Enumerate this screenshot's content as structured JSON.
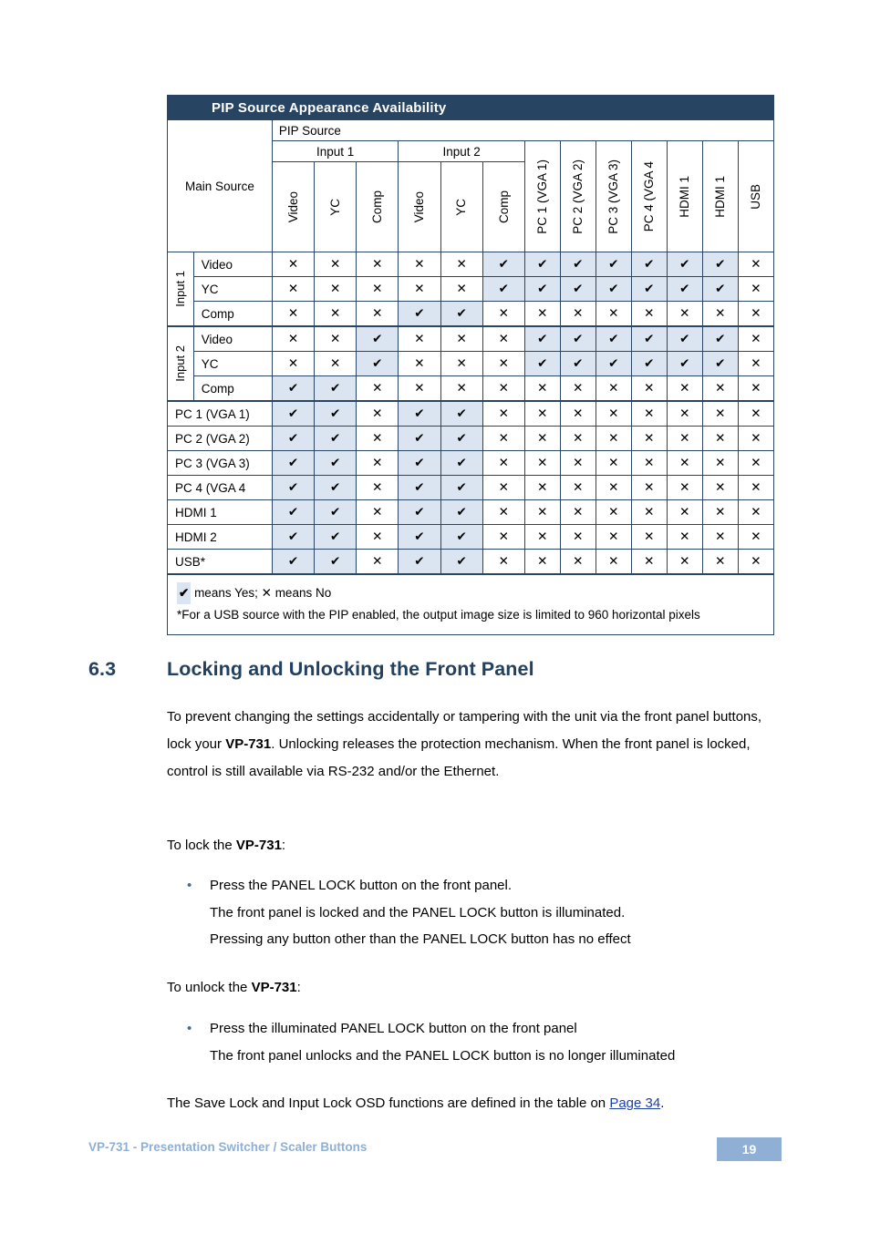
{
  "table": {
    "title": "PIP Source Appearance Availability",
    "main_source_label": "Main Source",
    "pip_source_label": "PIP Source",
    "group_input1": "Input 1",
    "group_input2": "Input 2",
    "columns": [
      "Video",
      "YC",
      "Comp",
      "Video",
      "YC",
      "Comp",
      "PC 1 (VGA 1)",
      "PC 2 (VGA 2)",
      "PC 3 (VGA 3)",
      "PC 4 (VGA 4",
      "HDMI 1",
      "HDMI 1",
      "USB"
    ],
    "row_group_1": "Input 1",
    "row_group_2": "Input 2",
    "rows": [
      {
        "label": "Video",
        "values": [
          "x",
          "x",
          "x",
          "x",
          "x",
          "v",
          "v",
          "v",
          "v",
          "v",
          "v",
          "v",
          "x"
        ]
      },
      {
        "label": "YC",
        "values": [
          "x",
          "x",
          "x",
          "x",
          "x",
          "v",
          "v",
          "v",
          "v",
          "v",
          "v",
          "v",
          "x"
        ]
      },
      {
        "label": "Comp",
        "values": [
          "x",
          "x",
          "x",
          "v",
          "v",
          "x",
          "x",
          "x",
          "x",
          "x",
          "x",
          "x",
          "x"
        ]
      },
      {
        "label": "Video",
        "values": [
          "x",
          "x",
          "v",
          "x",
          "x",
          "x",
          "v",
          "v",
          "v",
          "v",
          "v",
          "v",
          "x"
        ]
      },
      {
        "label": "YC",
        "values": [
          "x",
          "x",
          "v",
          "x",
          "x",
          "x",
          "v",
          "v",
          "v",
          "v",
          "v",
          "v",
          "x"
        ]
      },
      {
        "label": "Comp",
        "values": [
          "v",
          "v",
          "x",
          "x",
          "x",
          "x",
          "x",
          "x",
          "x",
          "x",
          "x",
          "x",
          "x"
        ]
      },
      {
        "label": "PC 1 (VGA 1)",
        "values": [
          "v",
          "v",
          "x",
          "v",
          "v",
          "x",
          "x",
          "x",
          "x",
          "x",
          "x",
          "x",
          "x"
        ]
      },
      {
        "label": "PC 2 (VGA 2)",
        "values": [
          "v",
          "v",
          "x",
          "v",
          "v",
          "x",
          "x",
          "x",
          "x",
          "x",
          "x",
          "x",
          "x"
        ]
      },
      {
        "label": "PC 3 (VGA 3)",
        "values": [
          "v",
          "v",
          "x",
          "v",
          "v",
          "x",
          "x",
          "x",
          "x",
          "x",
          "x",
          "x",
          "x"
        ]
      },
      {
        "label": "PC 4 (VGA 4",
        "values": [
          "v",
          "v",
          "x",
          "v",
          "v",
          "x",
          "x",
          "x",
          "x",
          "x",
          "x",
          "x",
          "x"
        ]
      },
      {
        "label": "HDMI 1",
        "values": [
          "v",
          "v",
          "x",
          "v",
          "v",
          "x",
          "x",
          "x",
          "x",
          "x",
          "x",
          "x",
          "x"
        ]
      },
      {
        "label": "HDMI 2",
        "values": [
          "v",
          "v",
          "x",
          "v",
          "v",
          "x",
          "x",
          "x",
          "x",
          "x",
          "x",
          "x",
          "x"
        ]
      },
      {
        "label": "USB*",
        "values": [
          "v",
          "v",
          "x",
          "v",
          "v",
          "x",
          "x",
          "x",
          "x",
          "x",
          "x",
          "x",
          "x"
        ]
      }
    ],
    "legend_yes_mark": "✔",
    "legend_yes_text": "means Yes;",
    "legend_no_mark": "✕",
    "legend_no_text": "means No",
    "legend_note": "*For a USB source with the PIP enabled, the output image size is limited to 960 horizontal pixels",
    "colors": {
      "header_bar": "#284463",
      "grid_line": "#2b4662",
      "yes_cell": "#dbe5f1"
    }
  },
  "section": {
    "number": "6.3",
    "title": "Locking and Unlocking the Front Panel"
  },
  "paragraphs": {
    "intro_a": "To prevent changing the settings accidentally or tampering with the unit via the front panel buttons, lock your ",
    "intro_bold": "VP-731",
    "intro_b": ". Unlocking releases the protection mechanism. When the front panel is locked, control is still available via RS-232 and/or the Ethernet.",
    "to_lock_a": "To lock the ",
    "to_lock_bold": "VP-731",
    "to_lock_b": ":",
    "to_unlock_a": "To unlock the ",
    "to_unlock_bold": "VP-731",
    "to_unlock_b": ":",
    "closing_a": "The Save Lock and Input Lock OSD functions are defined in the table on ",
    "closing_link": "Page 34",
    "closing_b": "."
  },
  "bullets_lock": [
    "Press the PANEL LOCK button on the front panel.",
    "The front panel is locked and the PANEL LOCK button is illuminated.",
    "Pressing any button other than the PANEL LOCK button has no effect"
  ],
  "bullets_unlock": [
    "Press the illuminated PANEL LOCK button on the front panel",
    "The front panel unlocks and the PANEL LOCK button is no longer illuminated"
  ],
  "footer": {
    "text": "VP-731 - Presentation Switcher / Scaler Buttons",
    "page_number": "19",
    "accent": "#8fafd4"
  }
}
